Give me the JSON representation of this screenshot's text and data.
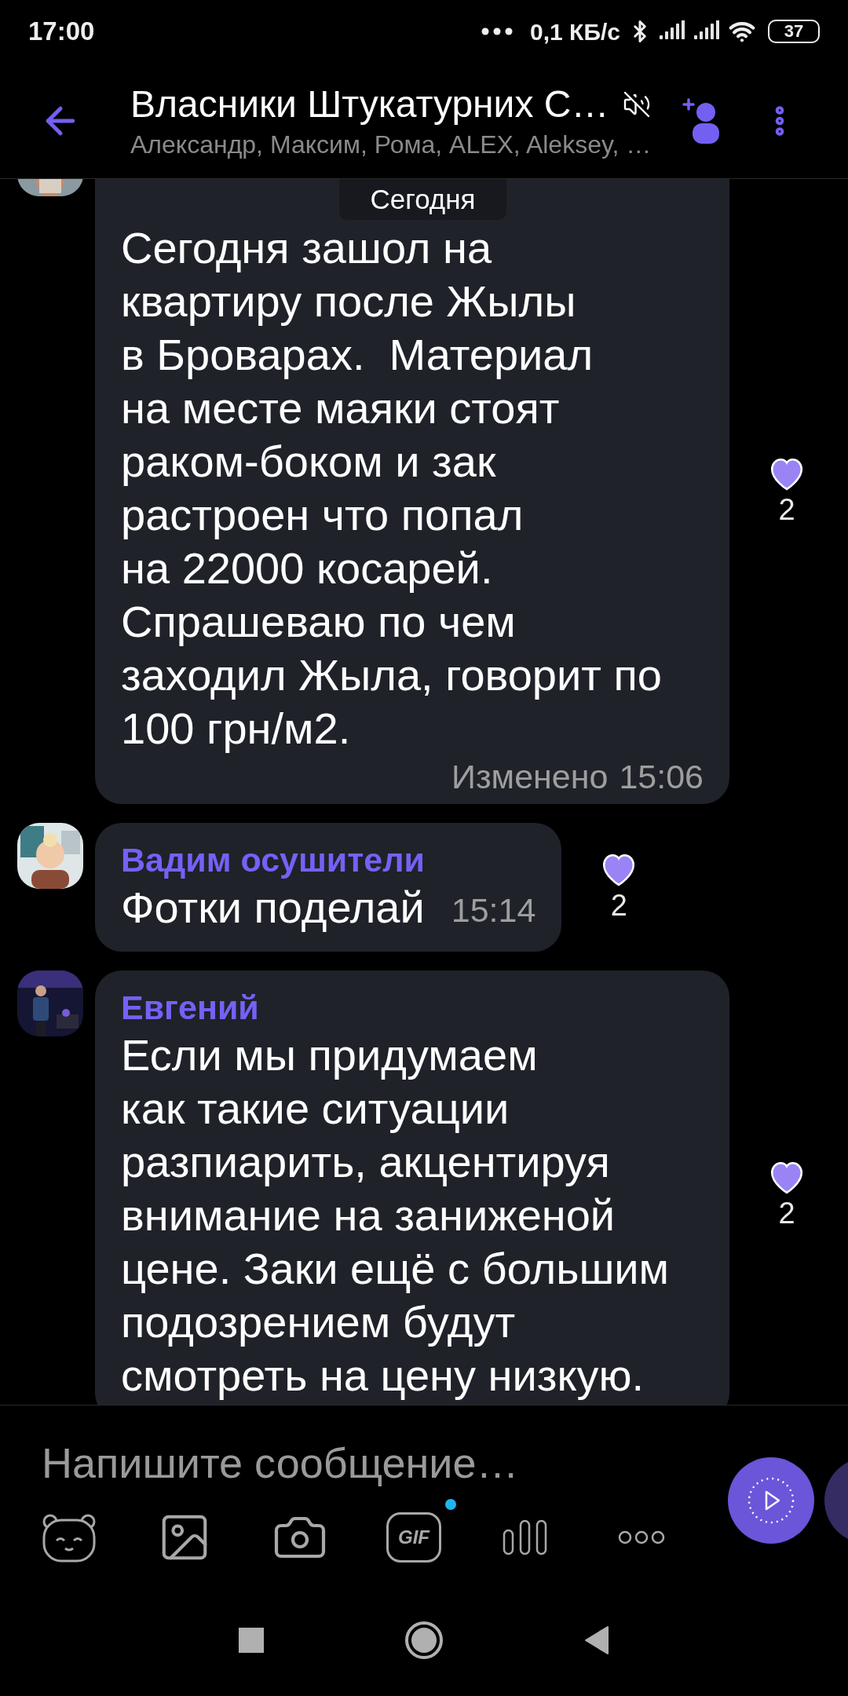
{
  "status_bar": {
    "time": "17:00",
    "network_speed": "0,1 КБ/с",
    "battery": "37"
  },
  "header": {
    "title": "Власники Штукатурних С…",
    "members": "Александр, Максим, Рома, ALEX, Aleksey, …",
    "muted": true
  },
  "date_label": "Сегодня",
  "messages": [
    {
      "text": "Сегодня зашол на\nквартиру после Жылы\nв Броварах.  Материал\nна месте маяки стоят\nраком-боком и зак\nрастроен что попал\nна 22000 косарей.\nСпрашеваю по чем\nзаходил Жыла, говорит по\n100 грн/м2.",
      "edited_label": "Изменено",
      "time": "15:06",
      "reaction_count": "2"
    },
    {
      "sender": "Вадим осушители",
      "text": "Фотки поделай",
      "time": "15:14",
      "reaction_count": "2"
    },
    {
      "sender": "Евгений",
      "text": "Если мы придумаем\nкак такие ситуации\nразпиарить, акцентируя\nвнимание на заниженой\nцене. Заки ещё с большим\nподозрением будут\nсмотреть на цену низкую.",
      "reaction_count": "2"
    }
  ],
  "composer": {
    "placeholder": "Напишите сообщение…",
    "gif_label": "GIF",
    "gif_new": true
  }
}
